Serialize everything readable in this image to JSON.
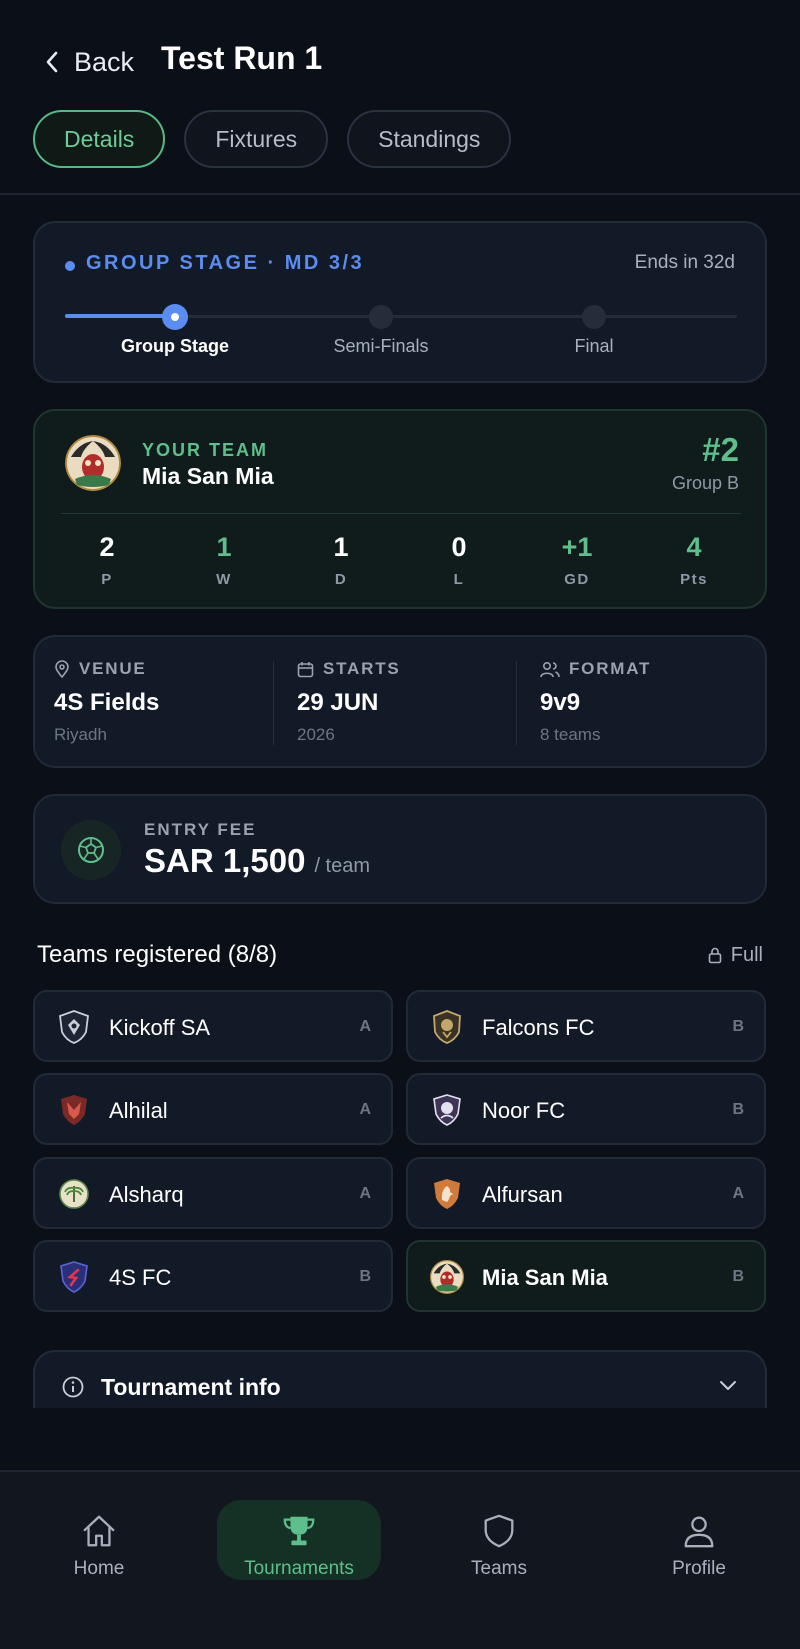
{
  "header": {
    "back_label": "Back",
    "title": "Test Run 1",
    "tabs": [
      {
        "label": "Details",
        "active": true
      },
      {
        "label": "Fixtures",
        "active": false
      },
      {
        "label": "Standings",
        "active": false
      }
    ]
  },
  "stage": {
    "label": "GROUP STAGE · MD 3/3",
    "ends": "Ends in 32d",
    "steps": [
      "Group Stage",
      "Semi-Finals",
      "Final"
    ],
    "current_step": 0
  },
  "your_team": {
    "label": "YOUR TEAM",
    "name": "Mia San Mia",
    "rank": "#2",
    "group": "Group B",
    "stats": [
      {
        "value": "2",
        "key": "P"
      },
      {
        "value": "1",
        "key": "W"
      },
      {
        "value": "1",
        "key": "D"
      },
      {
        "value": "0",
        "key": "L"
      },
      {
        "value": "+1",
        "key": "GD"
      },
      {
        "value": "4",
        "key": "Pts"
      }
    ]
  },
  "info": {
    "venue": {
      "label": "VENUE",
      "main": "4S Fields",
      "sub": "Riyadh"
    },
    "starts": {
      "label": "STARTS",
      "main": "29 JUN",
      "sub": "2026"
    },
    "format": {
      "label": "FORMAT",
      "main": "9v9",
      "sub": "8 teams"
    }
  },
  "fee": {
    "label": "ENTRY FEE",
    "amount": "SAR 1,500",
    "unit": "/ team"
  },
  "teams": {
    "title": "Teams registered (8/8)",
    "status": "Full",
    "list": [
      {
        "name": "Kickoff SA",
        "group": "A"
      },
      {
        "name": "Falcons FC",
        "group": "B"
      },
      {
        "name": "Alhilal",
        "group": "A"
      },
      {
        "name": "Noor FC",
        "group": "B"
      },
      {
        "name": "Alsharq",
        "group": "A"
      },
      {
        "name": "Alfursan",
        "group": "A"
      },
      {
        "name": "4S FC",
        "group": "B"
      },
      {
        "name": "Mia San Mia",
        "group": "B"
      }
    ]
  },
  "tournament_info": {
    "title": "Tournament info"
  },
  "nav": [
    {
      "label": "Home",
      "icon": "home-icon",
      "active": false
    },
    {
      "label": "Tournaments",
      "icon": "trophy-icon",
      "active": true
    },
    {
      "label": "Teams",
      "icon": "shield-icon",
      "active": false
    },
    {
      "label": "Profile",
      "icon": "user-icon",
      "active": false
    }
  ],
  "colors": {
    "background": "#0b0f17",
    "card": "#131a27",
    "accent_green": "#5fbf8c",
    "accent_blue": "#5b8cf0"
  }
}
